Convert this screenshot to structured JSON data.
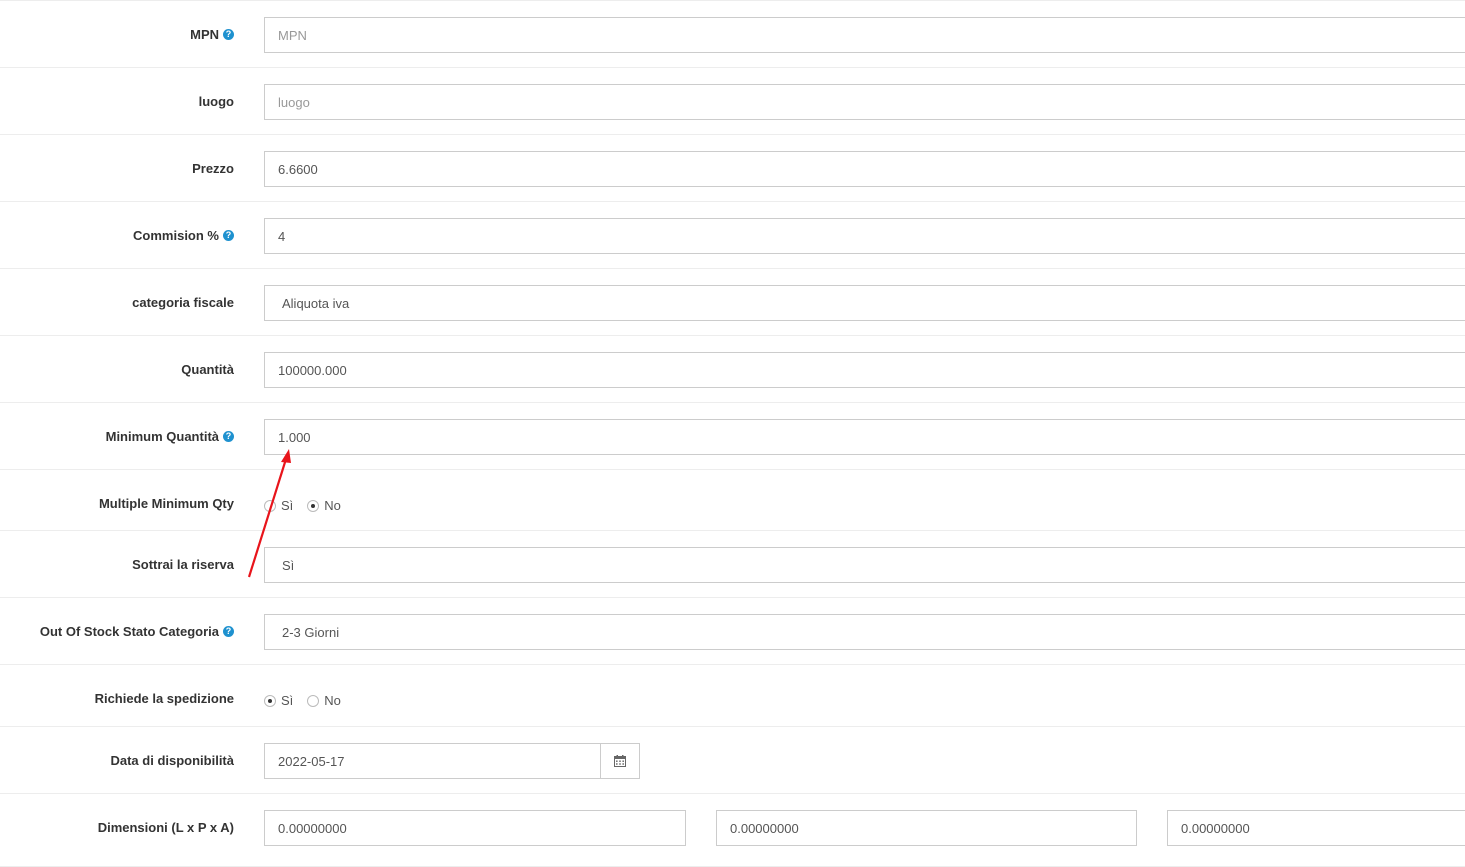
{
  "fields": {
    "mpn": {
      "label": "MPN",
      "placeholder": "MPN"
    },
    "luogo": {
      "label": "luogo",
      "placeholder": "luogo"
    },
    "prezzo": {
      "label": "Prezzo",
      "value": "6.6600"
    },
    "commision": {
      "label": "Commision %",
      "value": "4"
    },
    "categoria_fiscale": {
      "label": "categoria fiscale",
      "value": "Aliquota iva"
    },
    "quantita": {
      "label": "Quantità",
      "value": "100000.000"
    },
    "min_quantita": {
      "label": "Minimum Quantità",
      "value": "1.000"
    },
    "multiple_min_qty": {
      "label": "Multiple Minimum Qty",
      "options": [
        "Sì",
        "No"
      ],
      "selected": "No"
    },
    "sottrai_riserva": {
      "label": "Sottrai la riserva",
      "value": "Sì"
    },
    "out_of_stock": {
      "label": "Out Of Stock Stato Categoria",
      "value": "2-3 Giorni"
    },
    "richiede_spedizione": {
      "label": "Richiede la spedizione",
      "options": [
        "Sì",
        "No"
      ],
      "selected": "Sì"
    },
    "data_disponibilita": {
      "label": "Data di disponibilità",
      "value": "2022-05-17"
    },
    "dimensioni": {
      "label": "Dimensioni (L x P x A)",
      "values": [
        "0.00000000",
        "0.00000000",
        "0.00000000"
      ]
    }
  },
  "icons": {
    "help": "help-circle-icon",
    "calendar": "calendar-icon"
  },
  "colors": {
    "help": "#1e91cf",
    "arrow": "#e8141b"
  }
}
